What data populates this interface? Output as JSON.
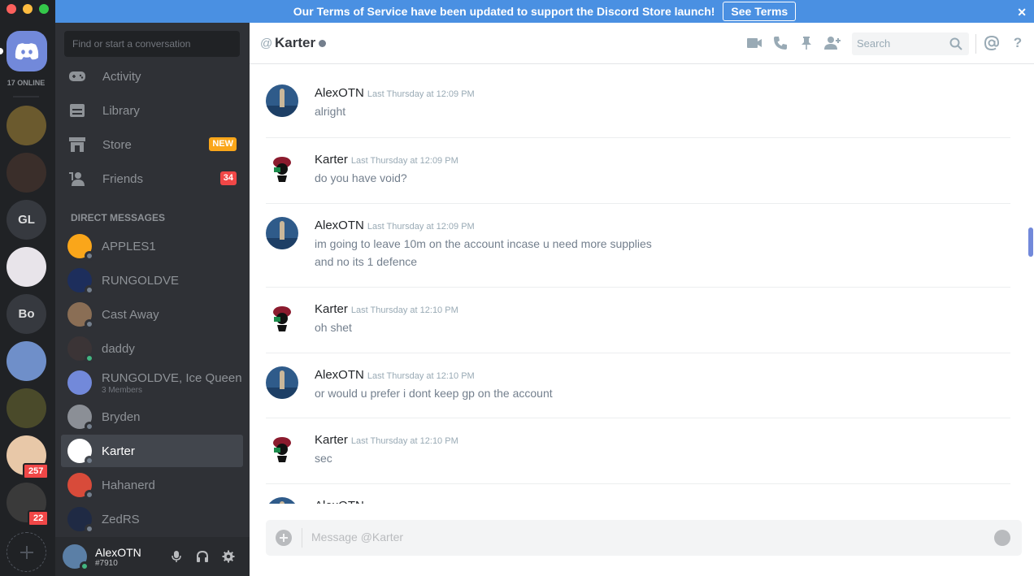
{
  "rail": {
    "online_label": "17 ONLINE",
    "guilds": [
      {
        "label": "",
        "color": "#6b5a2e"
      },
      {
        "label": "",
        "color": "#3a2e2a"
      },
      {
        "label": "GL",
        "color": "#36393f"
      },
      {
        "label": "",
        "color": "#e8e4ea"
      },
      {
        "label": "Bo",
        "color": "#36393f"
      },
      {
        "label": "",
        "color": "#6f8fc9"
      },
      {
        "label": "",
        "color": "#4a4a2a"
      },
      {
        "label": "",
        "color": "#e8c8a8"
      },
      {
        "label": "",
        "color": "#3a3a3a"
      }
    ],
    "badge_1": "257",
    "badge_2": "22"
  },
  "banner": {
    "text": "Our Terms of Service have been updated to support the Discord Store launch!",
    "button": "See Terms"
  },
  "sidebar": {
    "search_placeholder": "Find or start a conversation",
    "nav": [
      {
        "label": "Activity",
        "icon": "gamepad-icon"
      },
      {
        "label": "Library",
        "icon": "library-icon"
      },
      {
        "label": "Store",
        "icon": "store-icon",
        "badge": "NEW",
        "badge_color": "#faa61a"
      },
      {
        "label": "Friends",
        "icon": "friends-icon",
        "badge": "34",
        "badge_color": "#f04747"
      }
    ],
    "dm_header": "DIRECT MESSAGES",
    "dms": [
      {
        "name": "APPLES1",
        "avatar_color": "#faa61a",
        "status": "#747f8d"
      },
      {
        "name": "RUNGOLDVE",
        "avatar_color": "#1d2e5c",
        "status": "#747f8d"
      },
      {
        "name": "Cast Away",
        "avatar_color": "#8a6e55",
        "status": "#747f8d"
      },
      {
        "name": "daddy",
        "avatar_color": "#3b3436",
        "status": "#43b581"
      },
      {
        "name": "RUNGOLDVE, Ice Queen",
        "sub": "3 Members",
        "avatar_color": "#7289da"
      },
      {
        "name": "Bryden",
        "avatar_color": "#8b8f96",
        "status": "#747f8d"
      },
      {
        "name": "Karter",
        "avatar_color": "#ffffff",
        "status": "#747f8d"
      },
      {
        "name": "Hahanerd",
        "avatar_color": "#d84b3a",
        "status": "#747f8d"
      },
      {
        "name": "ZedRS",
        "avatar_color": "#1f2a44",
        "status": "#747f8d"
      }
    ],
    "user": {
      "name": "AlexOTN",
      "tag": "#7910"
    }
  },
  "chat": {
    "header_at": "@",
    "header_name": "Karter",
    "search_placeholder": "Search",
    "messages": [
      {
        "author": "AlexOTN",
        "time": "Last Thursday at 12:09 PM",
        "lines": [
          "alright"
        ],
        "avatar": "alex"
      },
      {
        "author": "Karter",
        "time": "Last Thursday at 12:09 PM",
        "lines": [
          "do you have void?"
        ],
        "avatar": "karter"
      },
      {
        "author": "AlexOTN",
        "time": "Last Thursday at 12:09 PM",
        "lines": [
          "im going to leave 10m on the account incase u need more supplies",
          "and no its 1 defence"
        ],
        "avatar": "alex"
      },
      {
        "author": "Karter",
        "time": "Last Thursday at 12:10 PM",
        "lines": [
          "oh shet"
        ],
        "avatar": "karter"
      },
      {
        "author": "AlexOTN",
        "time": "Last Thursday at 12:10 PM",
        "lines": [
          "or would u prefer i dont keep gp on the account"
        ],
        "avatar": "alex"
      },
      {
        "author": "Karter",
        "time": "Last Thursday at 12:10 PM",
        "lines": [
          "sec"
        ],
        "avatar": "karter"
      },
      {
        "author": "AlexOTN",
        "time": "",
        "lines": [],
        "avatar": "alex"
      }
    ],
    "composer_placeholder": "Message @Karter"
  },
  "colors": {
    "blurple": "#7289da",
    "online": "#43b581",
    "offline": "#747f8d",
    "mention_red": "#f04747",
    "banner_blue": "#4a90e2"
  }
}
